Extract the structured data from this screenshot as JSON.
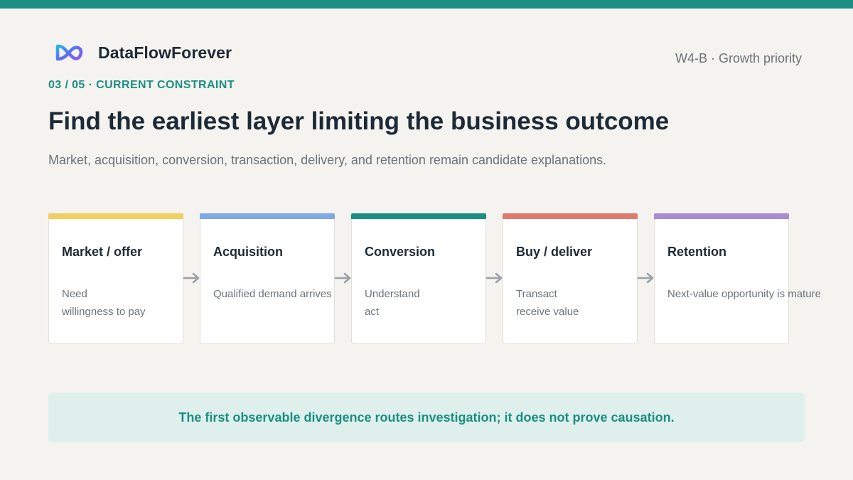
{
  "brand": {
    "name": "DataFlowForever",
    "logo_icon": "infinity-logo-icon",
    "logo_colors": [
      "#5b6ef5",
      "#2bb6e6",
      "#8a5cf0"
    ]
  },
  "header": {
    "meta": "W4-B · Growth priority",
    "kicker": "03 / 05 · CURRENT CONSTRAINT",
    "title": "Find the earliest layer limiting the business outcome",
    "subtitle": "Market, acquisition, conversion, transaction, delivery, and retention remain candidate explanations."
  },
  "theme": {
    "accent": "#1a8f82",
    "background": "#f4f3ef"
  },
  "stages": [
    {
      "title": "Market / offer",
      "lines": [
        "Need",
        "willingness to pay"
      ],
      "color": "#f0cf5f"
    },
    {
      "title": "Acquisition",
      "lines": [
        "Qualified demand arrives",
        ""
      ],
      "color": "#7fa8e6"
    },
    {
      "title": "Conversion",
      "lines": [
        "Understand",
        "act"
      ],
      "color": "#1a8f82"
    },
    {
      "title": "Buy / deliver",
      "lines": [
        "Transact",
        "receive value"
      ],
      "color": "#e07a6c"
    },
    {
      "title": "Retention",
      "lines": [
        "Next-value opportunity is mature",
        ""
      ],
      "color": "#a98bd4"
    }
  ],
  "connector_icon": "arrow-right-icon",
  "note": {
    "text": "The first observable divergence routes investigation; it does not prove causation."
  }
}
